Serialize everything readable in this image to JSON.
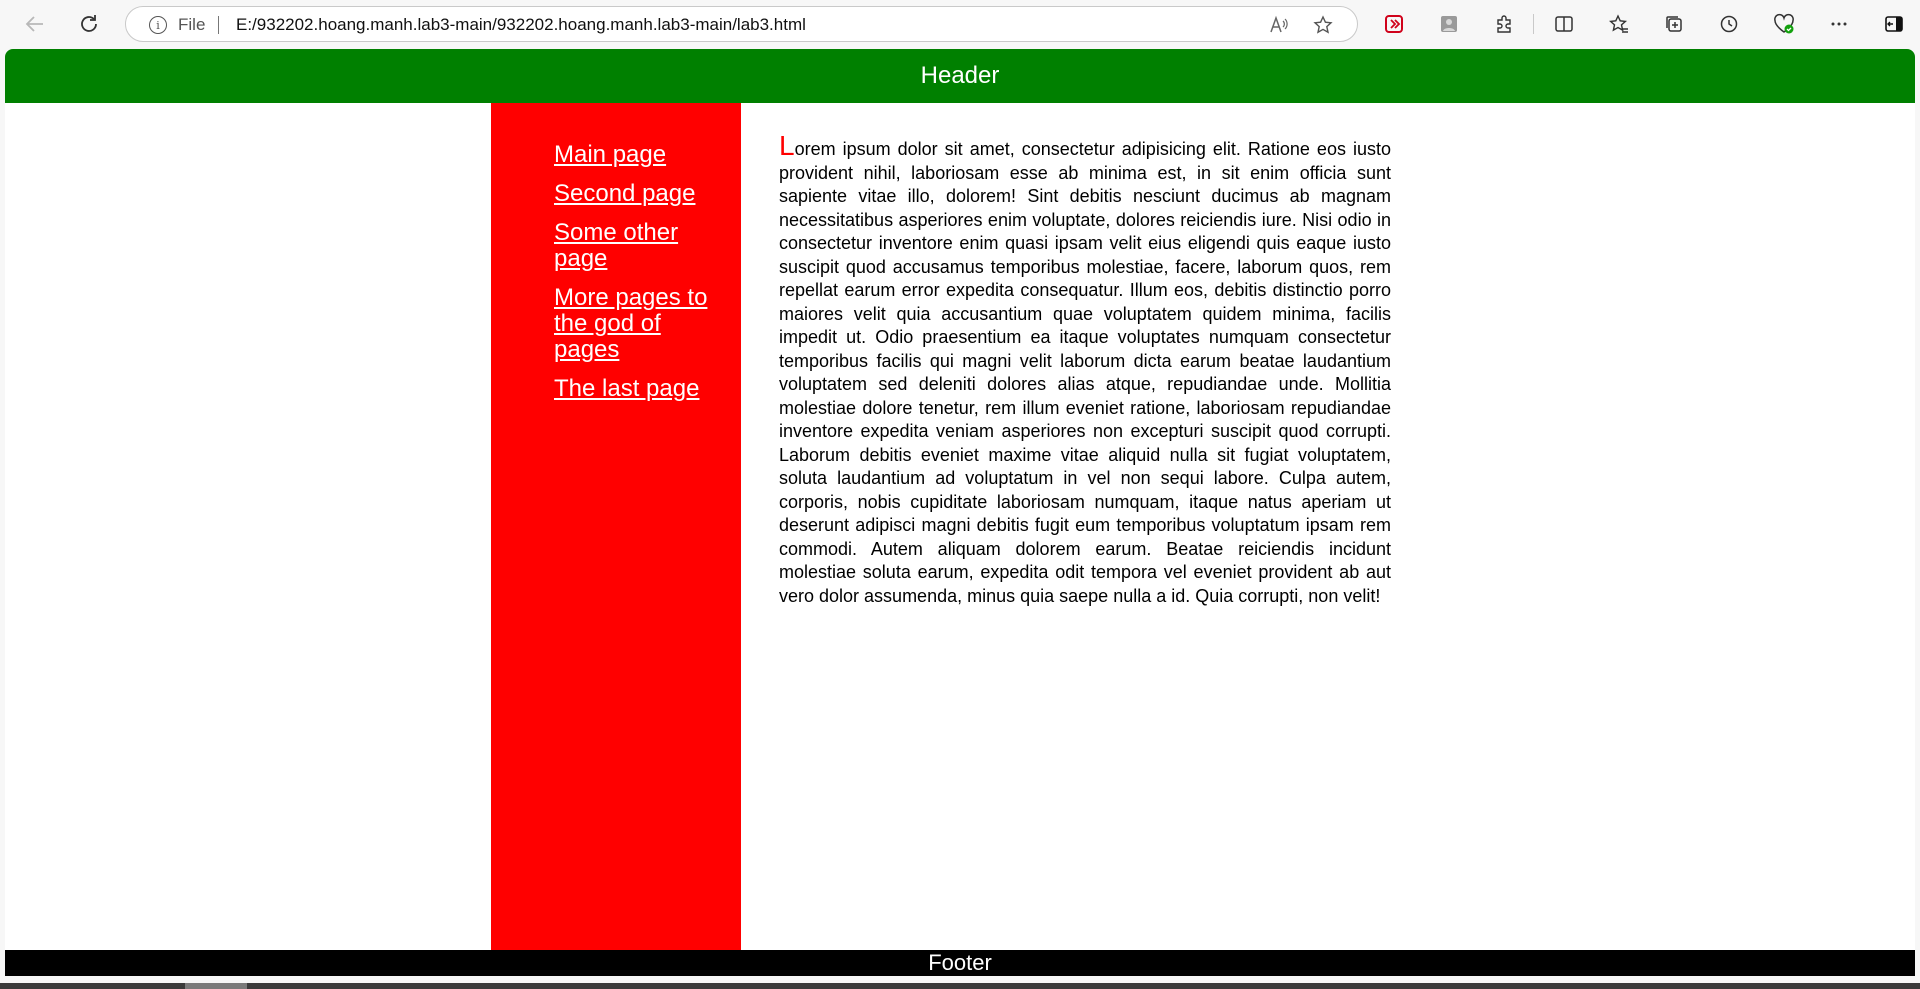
{
  "browser": {
    "back_icon": "arrow-left-icon",
    "refresh_icon": "refresh-icon",
    "address": {
      "scheme_label": "File",
      "url": "E:/932202.hoang.manh.lab3-main/932202.hoang.manh.lab3-main/lab3.html"
    },
    "read_aloud_icon": "read-aloud-icon",
    "favorite_icon": "star-icon"
  },
  "page": {
    "header": "Header",
    "nav": [
      "Main page",
      "Second page",
      "Some other page",
      "More pages to the god of pages",
      "The last page"
    ],
    "dropcap": "L",
    "body": "orem ipsum dolor sit amet, consectetur adipisicing elit. Ratione eos iusto provident nihil, laboriosam esse ab minima est, in sit enim officia sunt sapiente vitae illo, dolorem! Sint debitis nesciunt ducimus ab magnam necessitatibus asperiores enim voluptate, dolores reiciendis iure. Nisi odio in consectetur inventore enim quasi ipsam velit eius eligendi quis eaque iusto suscipit quod accusamus temporibus molestiae, facere, laborum quos, rem repellat earum error expedita consequatur. Illum eos, debitis distinctio porro maiores velit quia accusantium quae voluptatem quidem minima, facilis impedit ut. Odio praesentium ea itaque voluptates numquam consectetur temporibus facilis qui magni velit laborum dicta earum beatae laudantium voluptatem sed deleniti dolores alias atque, repudiandae unde. Mollitia molestiae dolore tenetur, rem illum eveniet ratione, laboriosam repudiandae inventore expedita veniam asperiores non excepturi suscipit quod corrupti. Laborum debitis eveniet maxime vitae aliquid nulla sit fugiat voluptatem, soluta laudantium ad voluptatum in vel non sequi labore. Culpa autem, corporis, nobis cupiditate laboriosam numquam, itaque natus aperiam ut deserunt adipisci magni debitis fugit eum temporibus voluptatum ipsam rem commodi. Autem aliquam dolorem earum. Beatae reiciendis incidunt molestiae soluta earum, expedita odit tempora vel eveniet provident ab aut vero dolor assumenda, minus quia saepe nulla a id. Quia corrupti, non velit!",
    "footer": "Footer"
  },
  "colors": {
    "header_bg": "#008000",
    "sidebar_bg": "#ff0000",
    "footer_bg": "#000000",
    "dropcap": "#ff0000"
  }
}
